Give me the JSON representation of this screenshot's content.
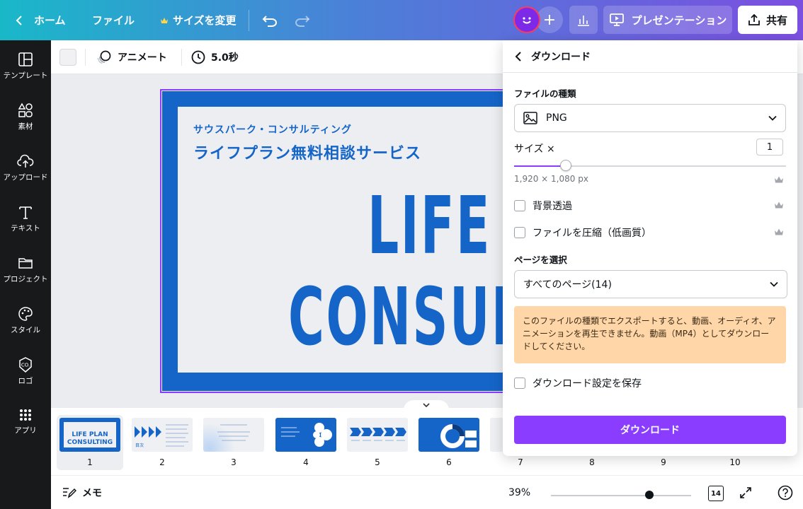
{
  "topbar": {
    "home_label": "ホーム",
    "file_label": "ファイル",
    "resize_label": "サイズを変更",
    "present_label": "プレゼンテーション",
    "share_label": "共有"
  },
  "sidebar": {
    "items": [
      {
        "label": "テンプレート",
        "icon": "template-icon"
      },
      {
        "label": "素材",
        "icon": "elements-icon"
      },
      {
        "label": "アップロード",
        "icon": "upload-icon"
      },
      {
        "label": "テキスト",
        "icon": "text-icon"
      },
      {
        "label": "プロジェクト",
        "icon": "folder-icon"
      },
      {
        "label": "スタイル",
        "icon": "palette-icon"
      },
      {
        "label": "ロゴ",
        "icon": "logo-icon"
      },
      {
        "label": "アプリ",
        "icon": "apps-icon"
      }
    ]
  },
  "toolbar": {
    "animate_label": "アニメート",
    "duration_label": "5.0秒"
  },
  "slide": {
    "subtitle": "サウスパーク・コンサルティング",
    "title": "ライフプラン無料相談サービス",
    "big_line1": "LIFE",
    "big_line2": "CONSUL"
  },
  "filmstrip": {
    "pages": [
      "1",
      "2",
      "3",
      "4",
      "5",
      "6",
      "7",
      "8",
      "9",
      "10"
    ],
    "active_page": "1",
    "thumb1_line1": "LIFE PLAN",
    "thumb1_line2": "CONSULTING",
    "thumb2_caption": "目次"
  },
  "bottombar": {
    "notes_label": "メモ",
    "zoom_label": "39%",
    "zoom_level": 0.39,
    "page_count": "14"
  },
  "download_panel": {
    "title": "ダウンロード",
    "file_type_label": "ファイルの種類",
    "file_type_value": "PNG",
    "size_label": "サイズ ×",
    "size_value": "1",
    "size_slider_fraction": 0.19,
    "dimensions": "1,920 × 1,080 px",
    "transparent_bg_label": "背景透過",
    "compress_label": "ファイルを圧縮（低画質）",
    "pages_label": "ページを選択",
    "pages_value": "すべてのページ(14)",
    "warning_text": "このファイルの種類でエクスポートすると、動画、オーディオ、アニメーションを再生できません。動画（MP4）としてダウンロードしてください。",
    "save_settings_label": "ダウンロード設定を保存",
    "download_button": "ダウンロード"
  },
  "colors": {
    "accent": "#8b3dff",
    "slide_blue": "#1565c8",
    "warning_bg": "#ffd6a8"
  }
}
